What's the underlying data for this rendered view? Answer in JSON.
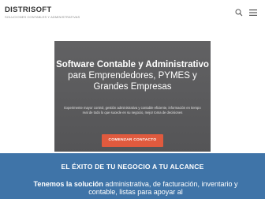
{
  "header": {
    "brand": "DISTRISOFT",
    "tagline": "SOLUCIONES CONTABLES Y ADMINISTRATIVAS",
    "search_icon": "search-icon",
    "menu_icon": "menu-icon"
  },
  "hero": {
    "title_bold": "Software Contable y Administrativo",
    "title_rest": "para Emprendedores, PYMES y Grandes Empresas",
    "description": "Experimente mayor control, gestión administrativa y contable eficiente, información en tiempo real de todo lo que sucede en su negocio, mejor toma de decisiones",
    "cta_label": "COMENZAR CONTACTO"
  },
  "band": {
    "title": "EL ÉXITO DE TU NEGOCIO A TU ALCANCE",
    "text_bold": "Tenemos la solución",
    "text_rest": "administrativa, de facturación, inventario y contable, listas para apoyar al"
  },
  "colors": {
    "hero_card": "#59595b",
    "cta": "#e05a3e",
    "band": "#3f74a8"
  }
}
